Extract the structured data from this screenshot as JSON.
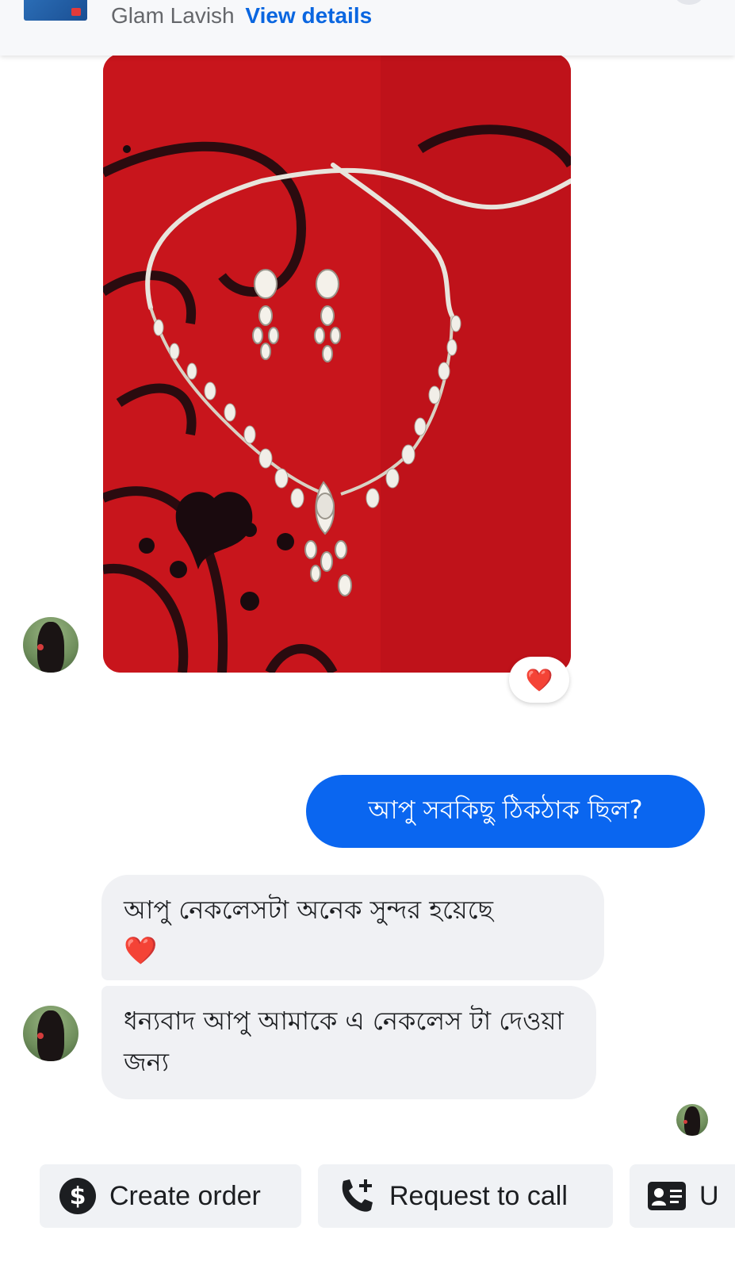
{
  "header": {
    "page_name": "Glam Lavish",
    "link_label": "View details"
  },
  "messages": {
    "photo_reaction": "❤️",
    "outgoing_1": "আপু সবকিছু ঠিকঠাক ছিল?",
    "incoming_1_text": "আপু নেকলেসটা অনেক সুন্দর হয়েছে",
    "incoming_1_emoji": "❤️",
    "incoming_2": "ধন্যবাদ আপু আমাকে এ নেকলেস টা দেওয়া জন্য"
  },
  "actions": {
    "create_order": "Create order",
    "request_call": "Request to call",
    "third_partial": "U"
  },
  "colors": {
    "accent": "#0a66f0",
    "bubble_in": "#f0f1f4",
    "photo_bg": "#c8151c",
    "heart": "#ec2b3a"
  },
  "icons": [
    "dollar-icon",
    "phone-plus-icon",
    "contact-card-icon",
    "heart-icon"
  ]
}
